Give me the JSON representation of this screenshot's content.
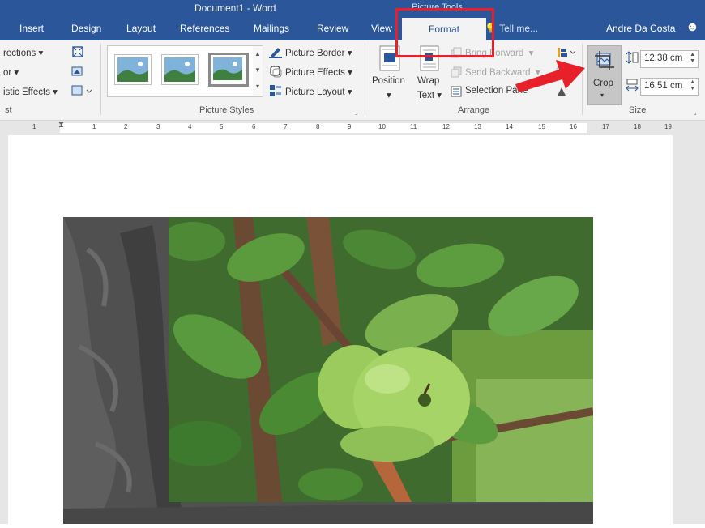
{
  "window": {
    "title": "Document1 - Word",
    "context_tab_group": "Picture Tools"
  },
  "tabs": [
    {
      "label": "Insert"
    },
    {
      "label": "Design"
    },
    {
      "label": "Layout"
    },
    {
      "label": "References"
    },
    {
      "label": "Mailings"
    },
    {
      "label": "Review"
    },
    {
      "label": "View"
    },
    {
      "label": "Format"
    }
  ],
  "tell_me": "Tell me...",
  "user_name": "Andre Da Costa",
  "ribbon": {
    "adjust": {
      "items": [
        "Directions",
        "Color",
        "Artistic Effects"
      ],
      "partial": [
        "rections ▾",
        "or ▾",
        "istic Effects ▾"
      ],
      "group_label": "st"
    },
    "picture_styles": {
      "group_label": "Picture Styles",
      "border": "Picture Border",
      "effects": "Picture Effects",
      "layout": "Picture Layout"
    },
    "arrange": {
      "group_label": "Arrange",
      "position": "Position",
      "wrap": "Wrap",
      "wrap2": "Text",
      "bring_forward": "Bring Forward",
      "send_backward": "Send Backward",
      "selection_pane": "Selection Pane"
    },
    "size": {
      "group_label": "Size",
      "crop": "Crop",
      "height": "12.38 cm",
      "width": "16.51 cm"
    }
  },
  "ruler_numbers": [
    "1",
    "1",
    "2",
    "3",
    "4",
    "5",
    "6",
    "7",
    "8",
    "9",
    "10",
    "11",
    "12",
    "13",
    "14",
    "15",
    "16",
    "17",
    "18",
    "19"
  ],
  "colors": {
    "ribbon_blue": "#2b579a",
    "annotation_red": "#e8202a"
  }
}
